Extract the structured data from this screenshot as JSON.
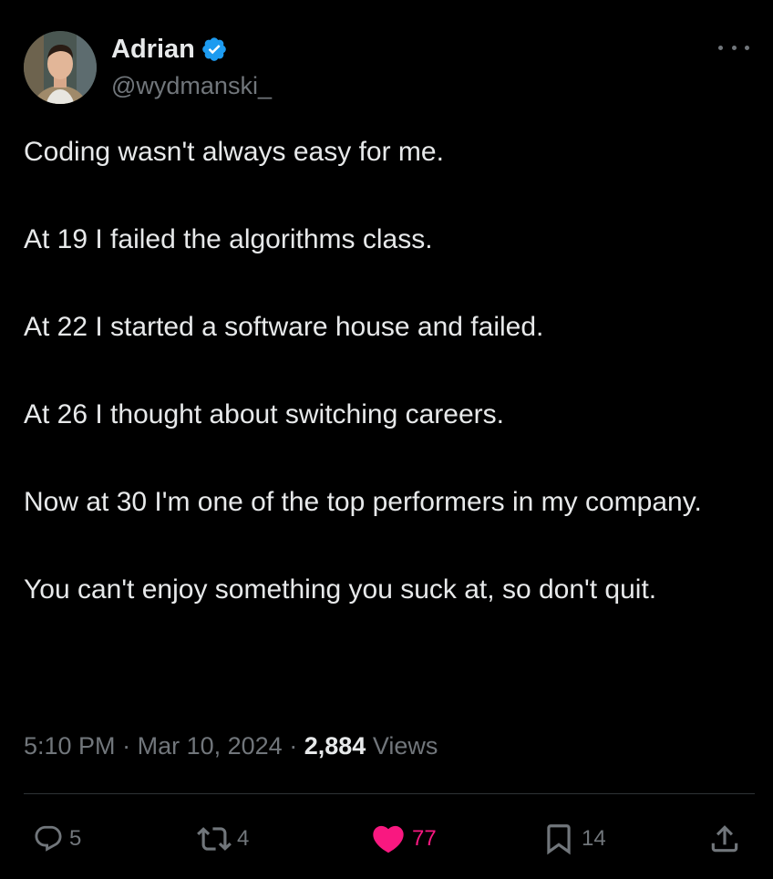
{
  "author": {
    "display_name": "Adrian",
    "handle": "@wydmanski_",
    "verified": true,
    "avatar_icon": "avatar-photo"
  },
  "tweet": {
    "paragraphs": [
      "Coding wasn't always easy for me.",
      "At 19 I failed the algorithms class.",
      "At 22 I started a software house and failed.",
      "At 26 I thought about switching careers.",
      "Now at 30 I'm one of the top performers in my company.",
      "You can't enjoy something you suck at, so don't quit."
    ],
    "time": "5:10 PM",
    "separator": "·",
    "date": "Mar 10, 2024",
    "views_count": "2,884",
    "views_label": "Views"
  },
  "actions": {
    "reply_count": "5",
    "retweet_count": "4",
    "like_count": "77",
    "bookmark_count": "14"
  },
  "colors": {
    "background": "#000000",
    "text": "#e7e9ea",
    "secondary": "#71767b",
    "verified_blue": "#1d9bf0",
    "like_pink": "#f91880",
    "divider": "#2f3336"
  },
  "icons": {
    "more": "more-horizontal-icon",
    "verified": "verified-badge-icon",
    "reply": "reply-icon",
    "retweet": "retweet-icon",
    "like": "heart-filled-icon",
    "bookmark": "bookmark-icon",
    "share": "share-icon"
  }
}
